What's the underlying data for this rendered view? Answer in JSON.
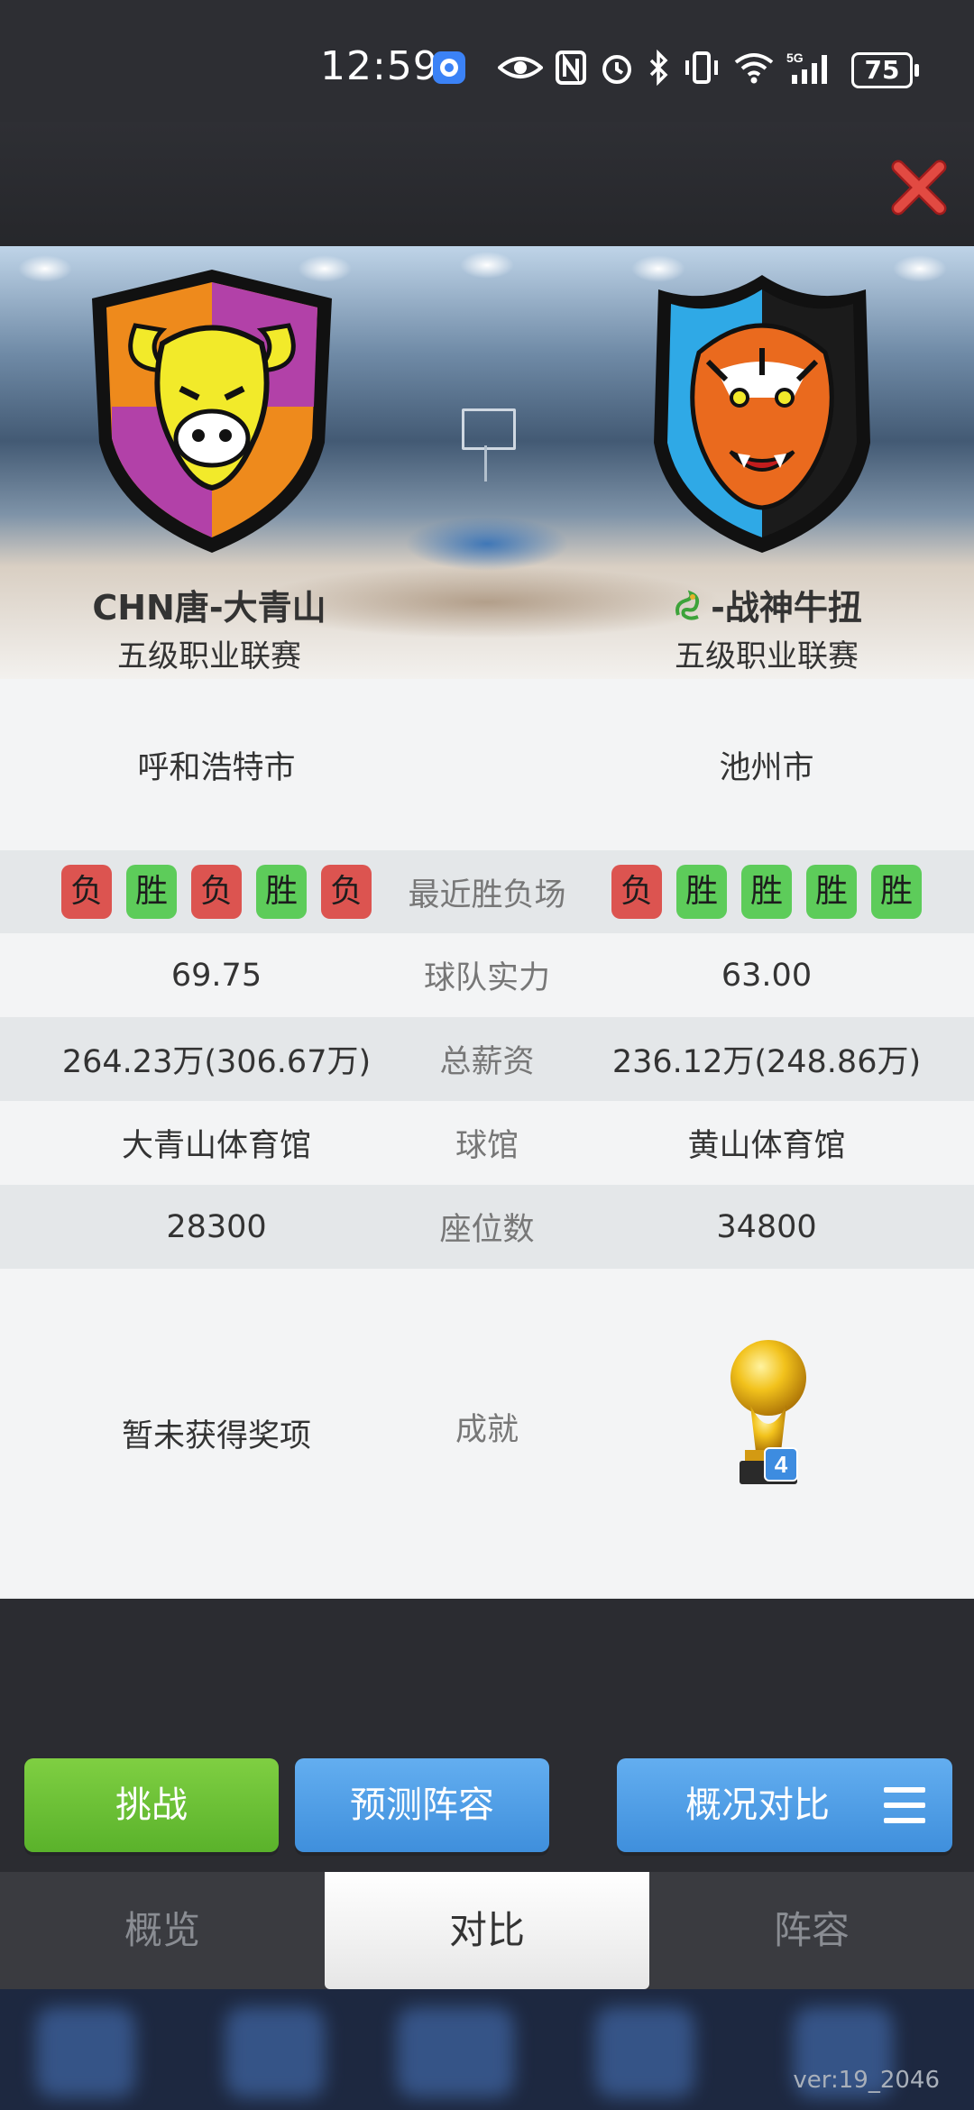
{
  "status_bar": {
    "time": "12:59",
    "battery": "75"
  },
  "home": {
    "name": "CHN唐-大青山",
    "league": "五级职业联赛",
    "city": "呼和浩特市",
    "recent": [
      "负",
      "胜",
      "负",
      "胜",
      "负"
    ],
    "strength": "69.75",
    "salary": "264.23万(306.67万)",
    "arena": "大青山体育馆",
    "seats": "28300",
    "achievement": "暂未获得奖项"
  },
  "away": {
    "name": "-战神牛扭",
    "league": "五级职业联赛",
    "city": "池州市",
    "recent": [
      "负",
      "胜",
      "胜",
      "胜",
      "胜"
    ],
    "strength": "63.00",
    "salary": "236.12万(248.86万)",
    "arena": "黄山体育馆",
    "seats": "34800",
    "trophy_count": "4"
  },
  "labels": {
    "recent": "最近胜负场",
    "strength": "球队实力",
    "salary": "总薪资",
    "arena": "球馆",
    "seats": "座位数",
    "achievement": "成就"
  },
  "actions": {
    "challenge": "挑战",
    "predict": "预测阵容",
    "overview_compare": "概况对比"
  },
  "tabs": [
    "概览",
    "对比",
    "阵容"
  ],
  "version": "ver:19_2046",
  "colors": {
    "win": "#5dcc5a",
    "loss": "#dc5450",
    "green_btn": "#6cc036",
    "blue_btn": "#4a9be6"
  }
}
